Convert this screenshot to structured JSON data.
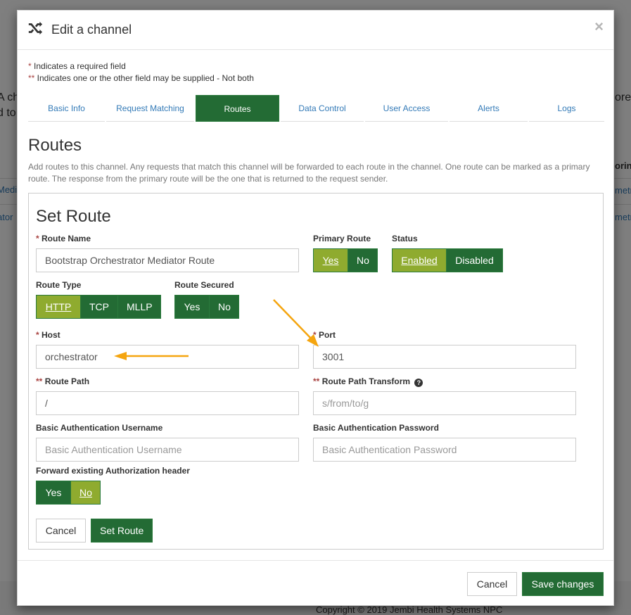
{
  "background": {
    "left_text_1": "A ch",
    "left_text_2": "d to",
    "left_link_1": "Media",
    "left_link_2": "ator",
    "right_text_1": "ore",
    "right_head": "oring",
    "right_link_1": "metri",
    "right_link_2": "metri",
    "footer": "Copyright ©  2019 Jembi Health Systems NPC"
  },
  "modal": {
    "title": "Edit a channel",
    "title_icon": "shuffle-icon",
    "close_label": "×",
    "legend_required_mark": "*",
    "legend_required_text": " Indicates a required field",
    "legend_either_mark": "**",
    "legend_either_text": " Indicates one or the other field may be supplied - Not both",
    "tabs": [
      {
        "label": "Basic Info",
        "active": false
      },
      {
        "label": "Request Matching",
        "active": false
      },
      {
        "label": "Routes",
        "active": true
      },
      {
        "label": "Data Control",
        "active": false
      },
      {
        "label": "User Access",
        "active": false
      },
      {
        "label": "Alerts",
        "active": false
      },
      {
        "label": "Logs",
        "active": false
      }
    ],
    "section_title": "Routes",
    "section_desc": "Add routes to this channel. Any requests that match this channel will be forwarded to each route in the channel. One route can be marked as a primary route. The response from the primary route will be the one that is returned to the request sender.",
    "footer": {
      "cancel_label": "Cancel",
      "save_label": "Save changes"
    }
  },
  "set_route": {
    "title": "Set Route",
    "route_name": {
      "mark": "*",
      "label": "Route Name",
      "value": "Bootstrap Orchestrator Mediator Route"
    },
    "primary_route": {
      "label": "Primary Route",
      "options": [
        "Yes",
        "No"
      ],
      "selected": "Yes"
    },
    "status": {
      "label": "Status",
      "options": [
        "Enabled",
        "Disabled"
      ],
      "selected": "Enabled"
    },
    "route_type": {
      "label": "Route Type",
      "options": [
        "HTTP",
        "TCP",
        "MLLP"
      ],
      "selected": "HTTP"
    },
    "route_secured": {
      "label": "Route Secured",
      "options": [
        "Yes",
        "No"
      ],
      "selected": null
    },
    "host": {
      "mark": "*",
      "label": "Host",
      "value": "orchestrator"
    },
    "port": {
      "mark": "*",
      "label": "Port",
      "value": "3001"
    },
    "route_path": {
      "mark": "**",
      "label": "Route Path",
      "value": "/"
    },
    "route_path_transform": {
      "mark": "**",
      "label": "Route Path Transform",
      "value": "",
      "placeholder": "s/from/to/g",
      "help_icon": "question-circle-icon"
    },
    "basic_auth_username": {
      "label": "Basic Authentication Username",
      "value": "",
      "placeholder": "Basic Authentication Username"
    },
    "basic_auth_password": {
      "label": "Basic Authentication Password",
      "value": "",
      "placeholder": "Basic Authentication Password"
    },
    "forward_auth": {
      "label": "Forward existing Authorization header",
      "options": [
        "Yes",
        "No"
      ],
      "selected": "No"
    },
    "cancel_label": "Cancel",
    "submit_label": "Set Route"
  },
  "annotations": {
    "color": "#f5a50f"
  }
}
